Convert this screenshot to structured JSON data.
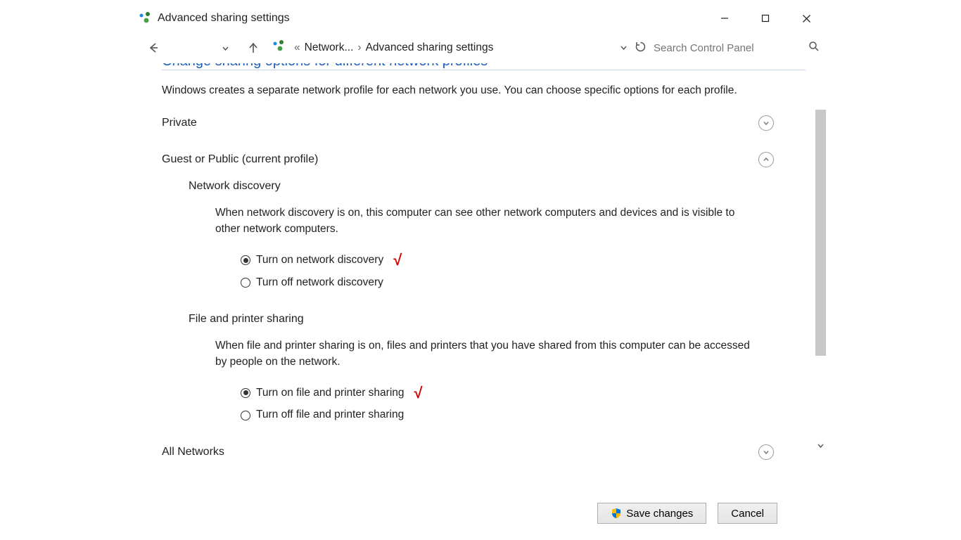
{
  "titlebar": {
    "title": "Advanced sharing settings"
  },
  "nav": {
    "crumb1": "Network...",
    "crumb2": "Advanced sharing settings",
    "search_placeholder": "Search Control Panel"
  },
  "page": {
    "heading": "Change sharing options for different network profiles",
    "description": "Windows creates a separate network profile for each network you use. You can choose specific options for each profile."
  },
  "profiles": {
    "private_label": "Private",
    "guest_label": "Guest or Public (current profile)",
    "all_label": "All Networks"
  },
  "network_discovery": {
    "title": "Network discovery",
    "description": "When network discovery is on, this computer can see other network computers and devices and is visible to other network computers.",
    "opt_on": "Turn on network discovery",
    "opt_off": "Turn off network discovery",
    "selected": "on"
  },
  "file_sharing": {
    "title": "File and printer sharing",
    "description": "When file and printer sharing is on, files and printers that you have shared from this computer can be accessed by people on the network.",
    "opt_on": "Turn on file and printer sharing",
    "opt_off": "Turn off file and printer sharing",
    "selected": "on"
  },
  "footer": {
    "save": "Save changes",
    "cancel": "Cancel"
  }
}
